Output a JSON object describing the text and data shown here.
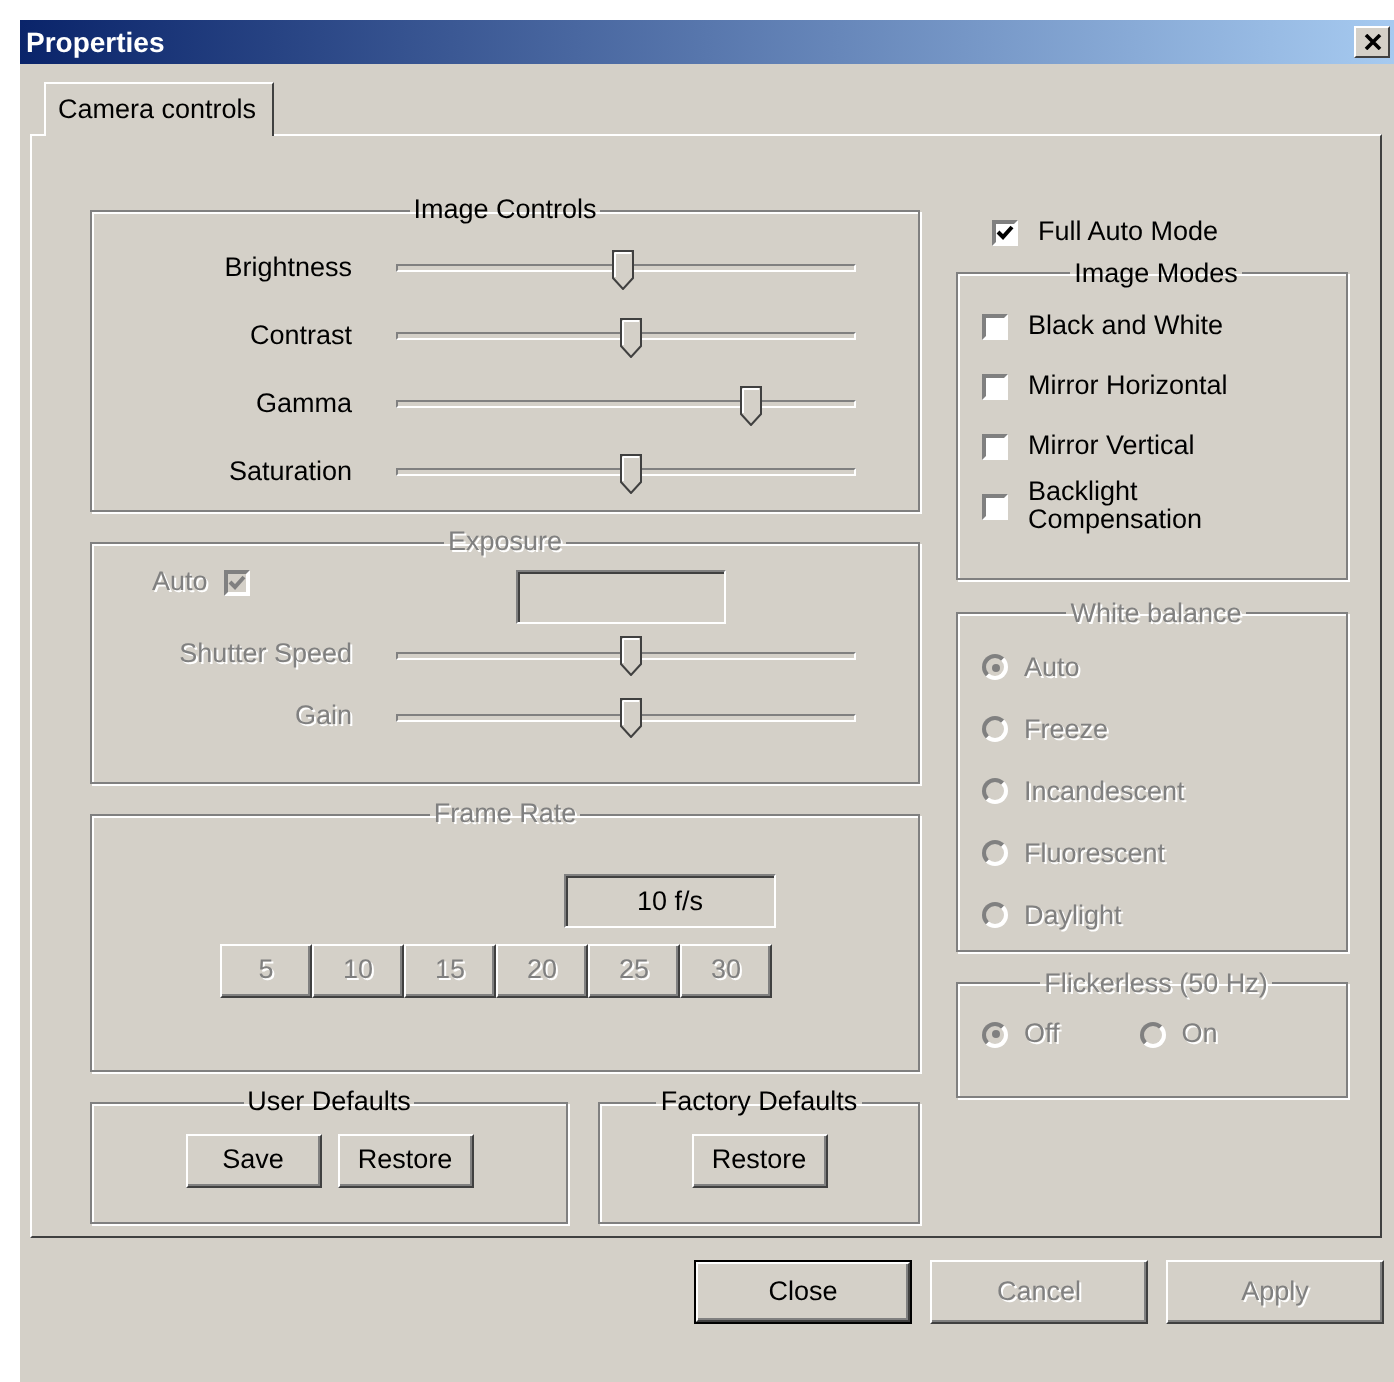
{
  "window": {
    "title": "Properties"
  },
  "tabs": [
    {
      "label": "Camera controls",
      "selected": true
    }
  ],
  "image_controls": {
    "title": "Image Controls",
    "disabled": false,
    "sliders": [
      {
        "label": "Brightness",
        "level": 0.49
      },
      {
        "label": "Contrast",
        "level": 0.51
      },
      {
        "label": "Gamma",
        "level": 0.77
      },
      {
        "label": "Saturation",
        "level": 0.51
      }
    ]
  },
  "exposure": {
    "title": "Exposure",
    "disabled": true,
    "auto": {
      "label": "Auto",
      "checked": true
    },
    "sliders": [
      {
        "label": "Shutter Speed",
        "level": 0.51
      },
      {
        "label": "Gain",
        "level": 0.51
      }
    ]
  },
  "frame_rate": {
    "title": "Frame Rate",
    "disabled": true,
    "reading": "10 f/s",
    "buttons": [
      "5",
      "10",
      "15",
      "20",
      "25",
      "30"
    ]
  },
  "user_defaults": {
    "title": "User Defaults",
    "buttons": [
      "Save",
      "Restore"
    ]
  },
  "factory_defaults": {
    "title": "Factory Defaults",
    "buttons": [
      "Restore"
    ]
  },
  "full_auto_mode": {
    "label": "Full Auto Mode",
    "checked": true
  },
  "image_modes": {
    "title": "Image Modes",
    "disabled": false,
    "options": [
      {
        "label": "Black and White",
        "checked": false
      },
      {
        "label": "Mirror Horizontal",
        "checked": false
      },
      {
        "label": "Mirror Vertical",
        "checked": false
      },
      {
        "label": "Backlight Compensation",
        "checked": false
      }
    ]
  },
  "white_balance": {
    "title": "White balance",
    "disabled": true,
    "options": [
      {
        "label": "Auto",
        "selected": true
      },
      {
        "label": "Freeze",
        "selected": false
      },
      {
        "label": "Incandescent",
        "selected": false
      },
      {
        "label": "Fluorescent",
        "selected": false
      },
      {
        "label": "Daylight",
        "selected": false
      }
    ]
  },
  "flickerless": {
    "title": "Flickerless (50 Hz)",
    "disabled": true,
    "options": [
      {
        "label": "Off",
        "selected": true
      },
      {
        "label": "On",
        "selected": false
      }
    ]
  },
  "footer_buttons": [
    {
      "label": "Close",
      "default": true,
      "disabled": false
    },
    {
      "label": "Cancel",
      "default": false,
      "disabled": true
    },
    {
      "label": "Apply",
      "default": false,
      "disabled": true
    }
  ]
}
